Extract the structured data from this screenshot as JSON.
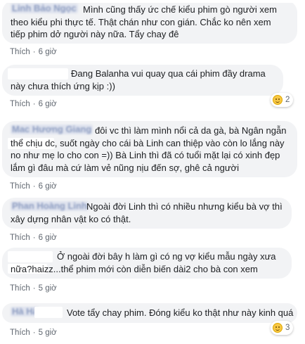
{
  "comments": [
    {
      "author": "Linh Bảo Ngọc",
      "text": "Mình cũng thấy ức chế kiểu phim gò người xem theo kiểu phi thực tế. Thật chán như con gián. Chắc ko nên xem tiếp phim dở người này nữa. Tẩy chay đê",
      "like": "Thích",
      "time": "6 giờ"
    },
    {
      "author": "",
      "text": "Đang Balanha vui quay qua cái phim đầy drama này chưa thích ứng kịp :))",
      "like": "Thích",
      "time": "6 giờ",
      "reaction_count": "2"
    },
    {
      "author": "Mac Hương Giang",
      "text": "đôi vc thì làm mình nổi cả da gà, bà Ngân ngẫn thể chịu dc, suốt ngày cho cái bà Linh can thiệp vào còn lo lắng này no như mẹ lo cho con =)) Bà Linh thì đã có tuổi mặt lại có xinh đẹp lắm gì đâu mà cứ làm vẻ nũng nịu đến sợ, ghê cả người",
      "like": "Thích",
      "time": "6 giờ"
    },
    {
      "author": "Phan Hoàng Linh",
      "text": "Ngoài đời Linh thì có nhiều nhưng kiểu bà vợ thì xây dựng nhân vật ko có thật.",
      "like": "Thích",
      "time": "6 giờ"
    },
    {
      "author": "",
      "text": "Ở ngoài đời bây h làm gì có ng vợ kiểu mẫu ngày xưa nữa?haizz...thể phim mới còn diễn biến dài2 cho bà con xem",
      "like": "Thích",
      "time": "5 giờ"
    },
    {
      "author": "Hà Hà",
      "text": "Vote tẩy chay phim. Đóng kiểu ko thật như này kinh quá",
      "like": "Thích",
      "time": "5 giờ",
      "reaction_count": "3"
    }
  ]
}
